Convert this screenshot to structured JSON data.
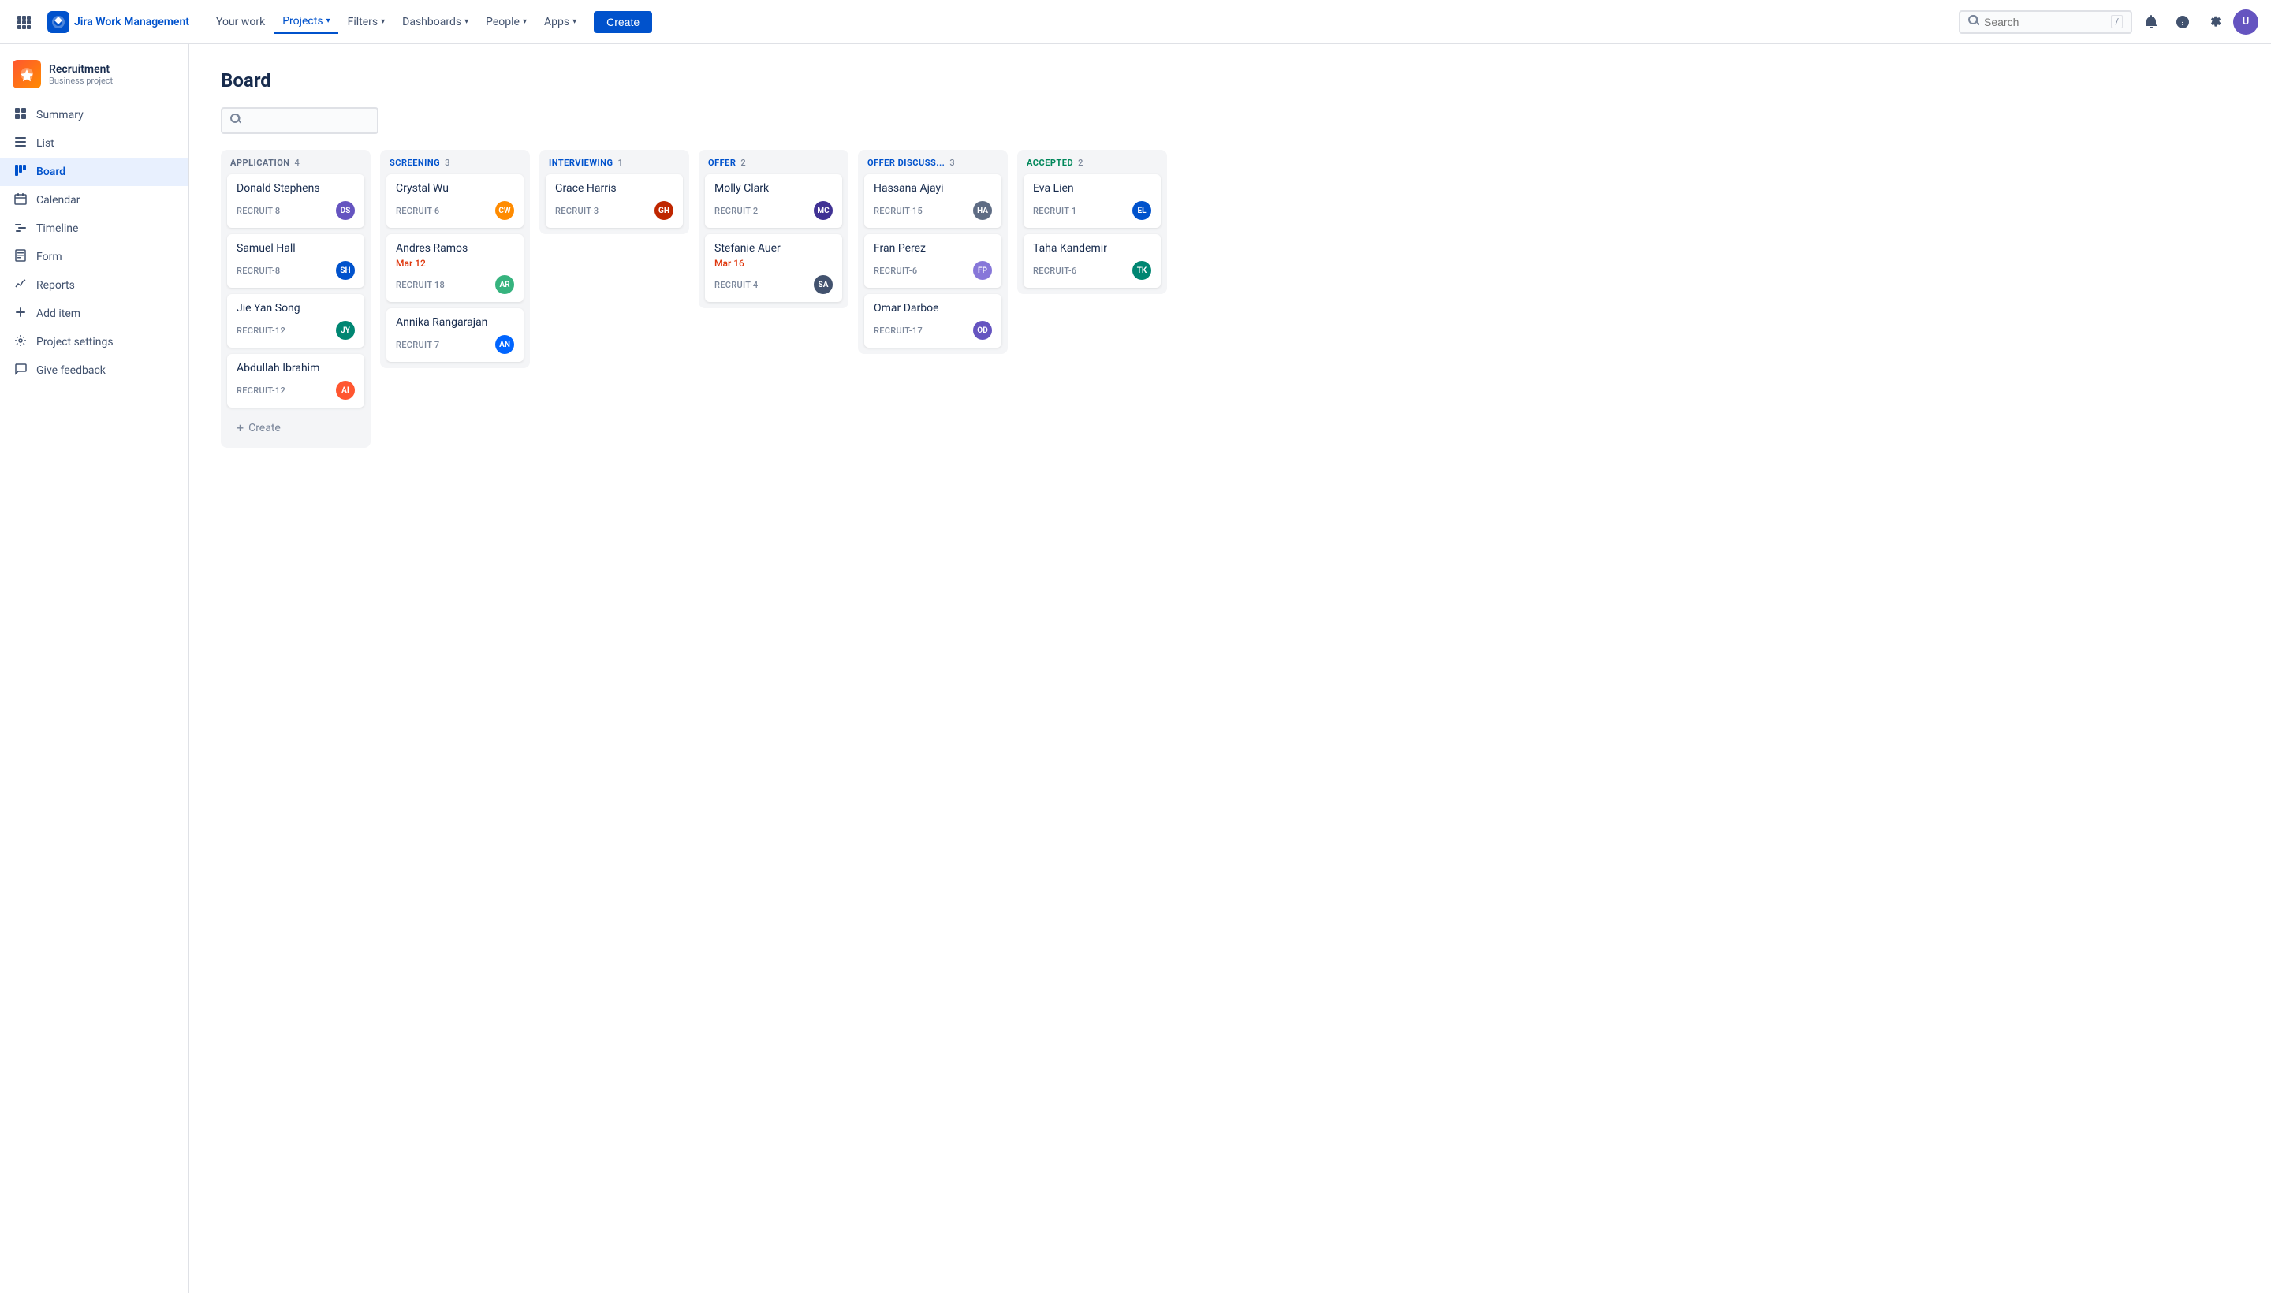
{
  "topnav": {
    "logo_text": "Jira Work Management",
    "links": [
      {
        "label": "Your work",
        "active": false
      },
      {
        "label": "Projects",
        "active": true
      },
      {
        "label": "Filters",
        "active": false
      },
      {
        "label": "Dashboards",
        "active": false
      },
      {
        "label": "People",
        "active": false
      },
      {
        "label": "Apps",
        "active": false
      }
    ],
    "create_label": "Create",
    "search_placeholder": "Search",
    "search_shortcut": "/"
  },
  "sidebar": {
    "project_name": "Recruitment",
    "project_type": "Business project",
    "nav_items": [
      {
        "id": "summary",
        "label": "Summary",
        "icon": "▦"
      },
      {
        "id": "list",
        "label": "List",
        "icon": "≡"
      },
      {
        "id": "board",
        "label": "Board",
        "icon": "⊞",
        "active": true
      },
      {
        "id": "calendar",
        "label": "Calendar",
        "icon": "📅"
      },
      {
        "id": "timeline",
        "label": "Timeline",
        "icon": "📊"
      },
      {
        "id": "form",
        "label": "Form",
        "icon": "📋"
      },
      {
        "id": "reports",
        "label": "Reports",
        "icon": "📈"
      },
      {
        "id": "add-item",
        "label": "Add item",
        "icon": "+"
      },
      {
        "id": "project-settings",
        "label": "Project settings",
        "icon": "⚙"
      },
      {
        "id": "give-feedback",
        "label": "Give feedback",
        "icon": "💬"
      }
    ]
  },
  "board": {
    "title": "Board",
    "search_placeholder": "",
    "columns": [
      {
        "id": "application",
        "label": "APPLICATION",
        "count": 4,
        "color": "gray",
        "cards": [
          {
            "name": "Donald Stephens",
            "id": "RECRUIT-8",
            "avatar_initials": "DS",
            "avatar_color": "av1"
          },
          {
            "name": "Samuel Hall",
            "id": "RECRUIT-8",
            "avatar_initials": "SH",
            "avatar_color": "av2"
          },
          {
            "name": "Jie Yan Song",
            "id": "RECRUIT-12",
            "avatar_initials": "JY",
            "avatar_color": "av3"
          },
          {
            "name": "Abdullah Ibrahim",
            "id": "RECRUIT-12",
            "avatar_initials": "AI",
            "avatar_color": "av4"
          }
        ],
        "show_create": true
      },
      {
        "id": "screening",
        "label": "SCREENING",
        "count": 3,
        "color": "blue",
        "cards": [
          {
            "name": "Crystal Wu",
            "id": "RECRUIT-6",
            "avatar_initials": "CW",
            "avatar_color": "av5"
          },
          {
            "name": "Andres Ramos",
            "id": "RECRUIT-18",
            "date": "Mar 12",
            "avatar_initials": "AR",
            "avatar_color": "av6"
          },
          {
            "name": "Annika Rangarajan",
            "id": "RECRUIT-7",
            "avatar_initials": "AN",
            "avatar_color": "av7"
          }
        ],
        "show_create": false
      },
      {
        "id": "interviewing",
        "label": "INTERVIEWING",
        "count": 1,
        "color": "blue",
        "cards": [
          {
            "name": "Grace Harris",
            "id": "RECRUIT-3",
            "avatar_initials": "GH",
            "avatar_color": "av8"
          }
        ],
        "show_create": false
      },
      {
        "id": "offer",
        "label": "OFFER",
        "count": 2,
        "color": "blue",
        "cards": [
          {
            "name": "Molly Clark",
            "id": "RECRUIT-2",
            "avatar_initials": "MC",
            "avatar_color": "av9"
          },
          {
            "name": "Stefanie Auer",
            "id": "RECRUIT-4",
            "date": "Mar 16",
            "avatar_initials": "SA",
            "avatar_color": "av10"
          }
        ],
        "show_create": false
      },
      {
        "id": "offer-discuss",
        "label": "OFFER DISCUSS...",
        "count": 3,
        "color": "blue",
        "cards": [
          {
            "name": "Hassana Ajayi",
            "id": "RECRUIT-15",
            "avatar_initials": "HA",
            "avatar_color": "av11"
          },
          {
            "name": "Fran Perez",
            "id": "RECRUIT-6",
            "avatar_initials": "FP",
            "avatar_color": "av12"
          },
          {
            "name": "Omar Darboe",
            "id": "RECRUIT-17",
            "avatar_initials": "OD",
            "avatar_color": "av1"
          }
        ],
        "show_create": false
      },
      {
        "id": "accepted",
        "label": "ACCEPTED",
        "count": 2,
        "color": "green",
        "cards": [
          {
            "name": "Eva Lien",
            "id": "RECRUIT-1",
            "avatar_initials": "EL",
            "avatar_color": "av2"
          },
          {
            "name": "Taha Kandemir",
            "id": "RECRUIT-6",
            "avatar_initials": "TK",
            "avatar_color": "av3"
          }
        ],
        "show_create": false
      }
    ]
  }
}
